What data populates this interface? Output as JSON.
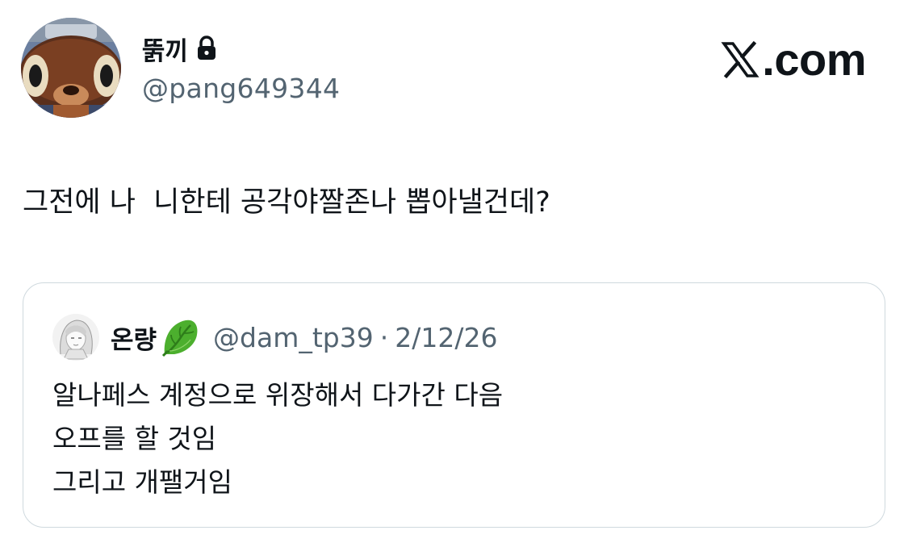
{
  "author": {
    "display_name": "뚥끼",
    "handle": "@pang649344",
    "avatar_icon": "raccoon-avatar",
    "lock_icon": "lock-icon"
  },
  "brand": {
    "label": ".com",
    "icon": "x-logo-icon"
  },
  "tweet": {
    "text": "그전에 나  니한테 공각야짤존나 뽑아낼건데?"
  },
  "quote": {
    "display_name": "온량",
    "emoji_icon": "lettuce-leaf-icon",
    "handle": "@dam_tp39",
    "separator": "·",
    "date": "2/12/26",
    "lines": [
      "알나페스 계정으로 위장해서 다가간 다음",
      "오프를 할 것임",
      "그리고 개팰거임"
    ]
  },
  "colors": {
    "text_primary": "#0f1419",
    "text_secondary": "#536471",
    "card_border": "#cfd9de",
    "leaf_green": "#3f9b2a"
  }
}
